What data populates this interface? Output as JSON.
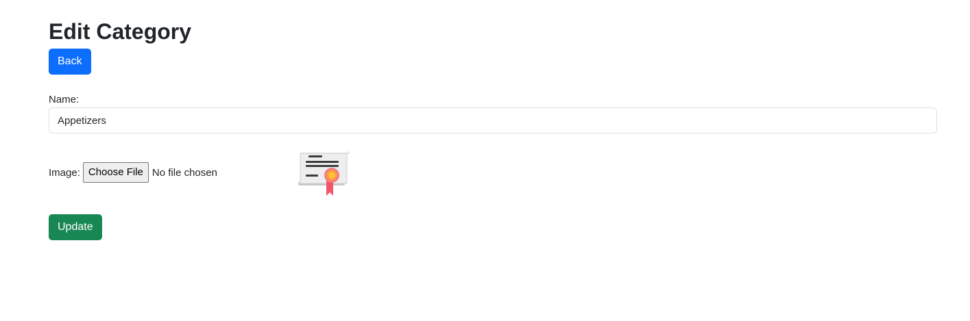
{
  "page": {
    "title": "Edit Category"
  },
  "actions": {
    "back_label": "Back",
    "update_label": "Update"
  },
  "form": {
    "name_label": "Name:",
    "name_value": "Appetizers",
    "image_label": "Image:",
    "file_button_label": "Choose File",
    "file_status": "No file chosen",
    "preview_icon": "certificate-icon"
  },
  "colors": {
    "primary": "#0d6efd",
    "success": "#198754",
    "text": "#212529"
  }
}
